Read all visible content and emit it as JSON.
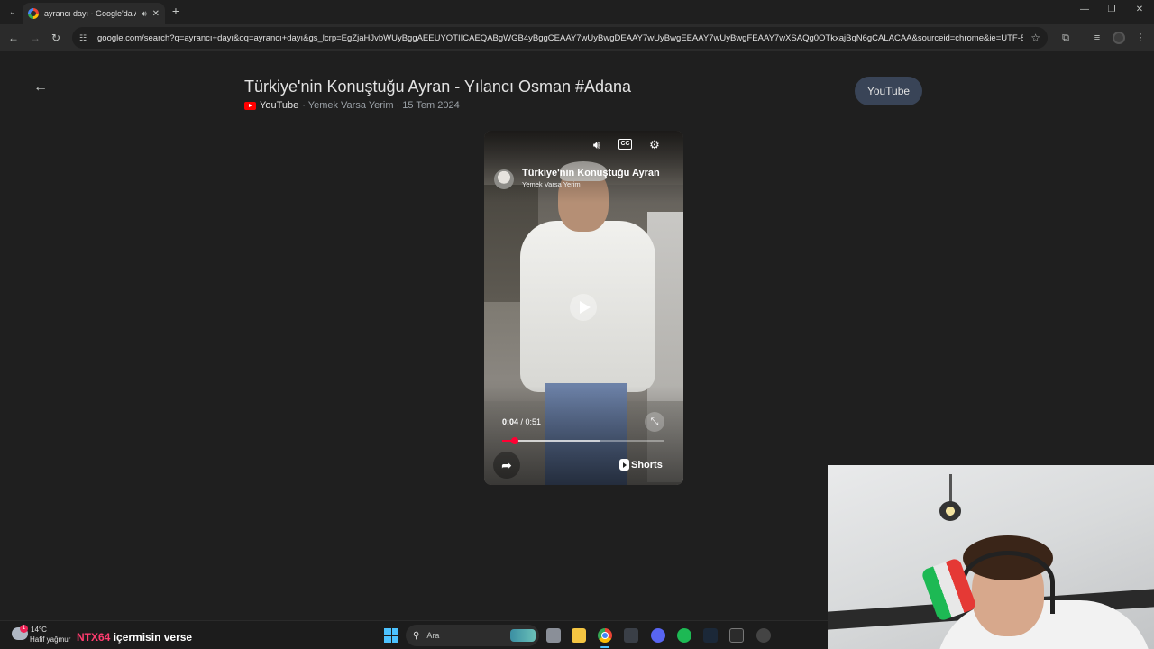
{
  "browser": {
    "tab": {
      "title": "ayrancı dayı - Google'da Ara",
      "audio_icon": "speaker-icon",
      "close_icon": "close-icon"
    },
    "new_tab_icon": "plus-icon",
    "window_controls": [
      "minimize-icon",
      "restore-icon",
      "close-icon"
    ],
    "url": "google.com/search?q=ayrancı+dayı&oq=ayrancı+dayı&gs_lcrp=EgZjaHJvbWUyBggAEEUYOTIICAEQABgWGB4yBggCEAAY7wUyBwgDEAAY7wUyBwgEEAAY7wUyBwgFEAAY7wXSAQg0OTkxajBqN6gCALACAA&sourceid=chrome&ie=UTF-8#fpstate=ive&vld=cid:88bb..."
  },
  "video": {
    "title": "Türkiye'nin Konuştuğu Ayran - Yılancı Osman #Adana",
    "source": "YouTube",
    "channel_date": "· Yemek Varsa Yerim · 15 Tem 2024",
    "youtube_button": "YouTube"
  },
  "player": {
    "overlay_title": "Türkiye'nin Konuştuğu Ayran",
    "channel": "Yemek Varsa Yerim",
    "cc_label": "CC",
    "current_time": "0:04",
    "duration": "/ 0:51",
    "progress_fraction": 0.08,
    "buffer_fraction": 0.6,
    "shorts_label": "Shorts"
  },
  "taskbar": {
    "weather_temp": "14°C",
    "weather_desc": "Hafif yağmur",
    "weather_badge": "1",
    "overlay_tag": "NTX64",
    "overlay_msg": "içermisin verse",
    "search_label": "Ara",
    "accent": "#4cc2ff"
  },
  "colors": {
    "page_bg": "#1f1f1f",
    "youtube_red": "#ff0000",
    "progress_red": "#ff0033",
    "pill_bg": "#394457"
  }
}
